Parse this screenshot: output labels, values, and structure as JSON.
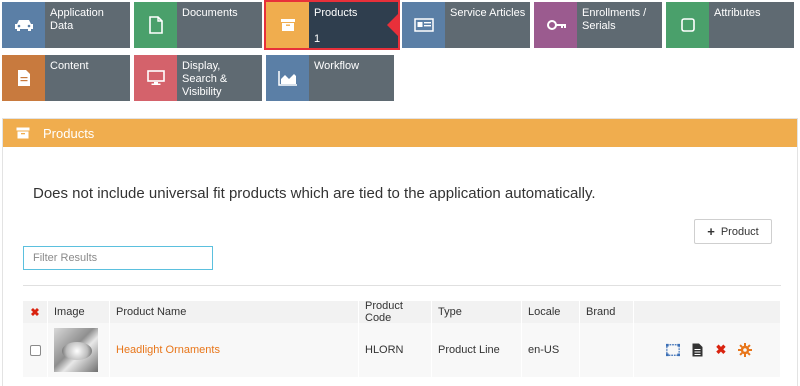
{
  "tiles": [
    {
      "label": "Application Data",
      "icon": "car-icon",
      "color": "#5b7fa6"
    },
    {
      "label": "Documents",
      "icon": "document-icon",
      "color": "#4aa06b"
    },
    {
      "label": "Products",
      "icon": "box-icon",
      "color": "#f0ad4e",
      "count": "1"
    },
    {
      "label": "Service Articles",
      "icon": "id-card-icon",
      "color": "#5b7fa6"
    },
    {
      "label": "Enrollments / Serials",
      "icon": "key-icon",
      "color": "#9b5b8f"
    },
    {
      "label": "Attributes",
      "icon": "checkbox-icon",
      "color": "#4aa06b"
    },
    {
      "label": "Content",
      "icon": "content-icon",
      "color": "#c87a3e"
    },
    {
      "label": "Display, Search & Visibility",
      "icon": "monitor-icon",
      "color": "#d4626b"
    },
    {
      "label": "Workflow",
      "icon": "area-chart-icon",
      "color": "#5b7fa6"
    }
  ],
  "panel": {
    "title": "Products",
    "notice": "Does not include universal fit products which are tied to the application automatically.",
    "add_button": "Product",
    "filter_placeholder": "Filter Results"
  },
  "table": {
    "headers": [
      "Image",
      "Product Name",
      "Product Code",
      "Type",
      "Locale",
      "Brand"
    ],
    "rows": [
      {
        "name": "Headlight Ornaments",
        "code": "HLORN",
        "type": "Product Line",
        "locale": "en-US",
        "brand": ""
      }
    ]
  },
  "colors": {
    "accent": "#f0ad4e",
    "link": "#e8761a",
    "active_outline": "#e8303a",
    "tile_body": "#5f6a72",
    "active_body": "#2f3e4e"
  }
}
